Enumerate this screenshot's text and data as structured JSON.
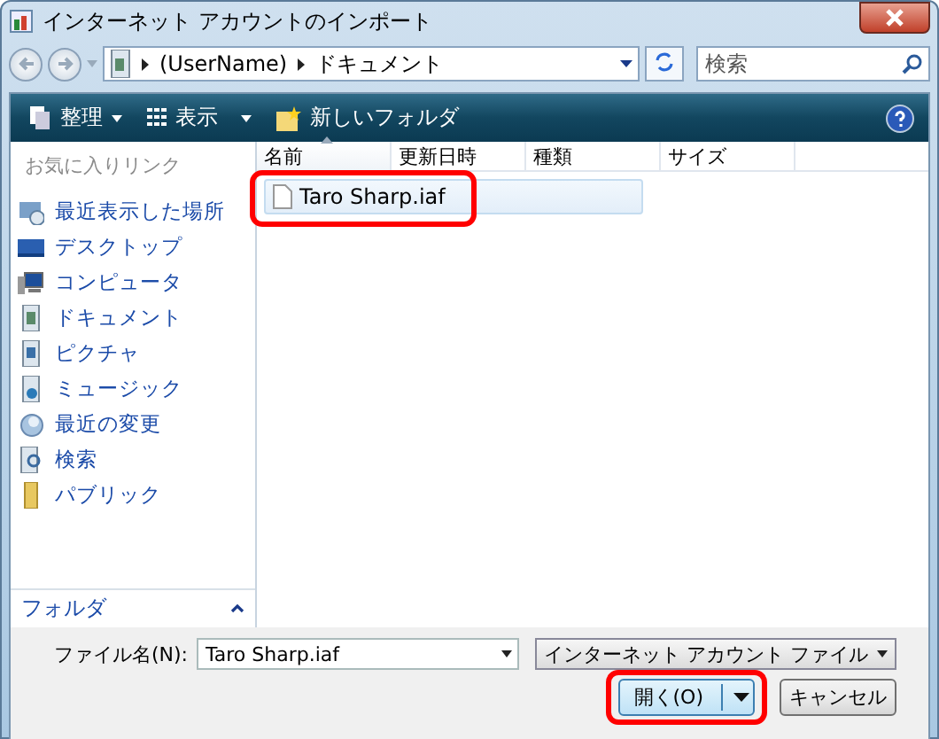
{
  "window": {
    "title": "インターネット アカウントのインポート"
  },
  "address_bar": {
    "path": [
      {
        "label": "(UserName)"
      },
      {
        "label": "ドキュメント"
      }
    ]
  },
  "search": {
    "placeholder": "検索"
  },
  "toolbar": {
    "items": [
      {
        "label": "整理",
        "kind": "organize"
      },
      {
        "label": "表示",
        "kind": "views"
      },
      {
        "label": "新しいフォルダ",
        "kind": "newfolder"
      }
    ]
  },
  "sidebar": {
    "heading": "お気に入りリンク",
    "items": [
      {
        "label": "最近表示した場所",
        "kind": "recent"
      },
      {
        "label": "デスクトップ",
        "kind": "desktop"
      },
      {
        "label": "コンピュータ",
        "kind": "computer"
      },
      {
        "label": "ドキュメント",
        "kind": "documents"
      },
      {
        "label": "ピクチャ",
        "kind": "pictures"
      },
      {
        "label": "ミュージック",
        "kind": "music"
      },
      {
        "label": "最近の変更",
        "kind": "changes"
      },
      {
        "label": "検索",
        "kind": "search"
      },
      {
        "label": "パブリック",
        "kind": "public"
      }
    ],
    "folders": {
      "label": "フォルダ",
      "expanded": false
    }
  },
  "file_list": {
    "columns": [
      "名前",
      "更新日時",
      "種類",
      "サイズ"
    ],
    "rows": [
      {
        "name": "Taro Sharp.iaf",
        "selected": true,
        "highlighted": true
      }
    ]
  },
  "footer": {
    "filename_label": "ファイル名(N):",
    "filename": "Taro Sharp.iaf",
    "filter": "インターネット アカウント ファイル",
    "buttons": [
      {
        "label": "開く(O)",
        "kind": "split",
        "highlighted": true
      },
      {
        "label": "キャンセル",
        "kind": "plain"
      }
    ]
  }
}
